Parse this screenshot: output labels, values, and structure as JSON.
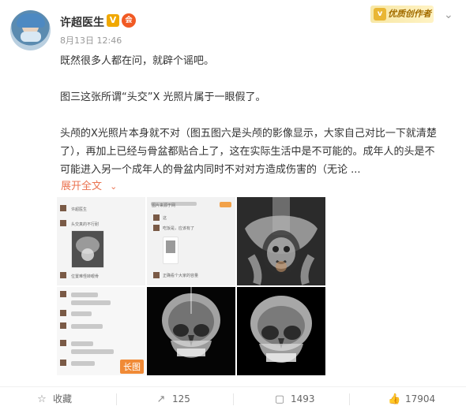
{
  "post": {
    "author": "许超医生",
    "verified_mark": "V",
    "vip_mark": "会",
    "date": "8月13日",
    "time": "12:46",
    "paragraphs": [
      "既然很多人都在问，就辟个谣吧。",
      "图三这张所谓“头交”X 光照片属于一眼假了。",
      "头颅的X光照片本身就不对（图五图六是头颅的影像显示，大家自己对比一下就清楚了），再加上已经与骨盆都贴合上了，这在实际生活中是不可能的。成年人的头是不可能进入另一个成年人的骨盆内同时不对对方造成伤害的（无论 ..."
    ],
    "expand_label": "展开全文",
    "expand_icon": "chevron-down-icon",
    "promo_badge": "优质创作者",
    "promo_icon": "v",
    "more_icon": "chevron-down-icon",
    "long_image_label": "长图"
  },
  "thumbnails": {
    "t1_lines": [
      "许超医生",
      "头交真的不行耐",
      "位置难怪转眼骨"
    ],
    "t2_lines": [
      "图片来源于网",
      "这",
      "吃饭是，应该有了",
      "正确看个大家的容量"
    ]
  },
  "actions": {
    "favorite": {
      "label": "收藏",
      "icon": "star-icon"
    },
    "repost": {
      "label": "125",
      "icon": "repost-icon"
    },
    "comment": {
      "label": "1493",
      "icon": "comment-icon"
    },
    "like": {
      "label": "17904",
      "icon": "thumb-up-icon"
    }
  },
  "colors": {
    "accent": "#eb7350",
    "verified": "#f0a800",
    "vip": "#f15a24",
    "long_image": "#f08a36"
  }
}
